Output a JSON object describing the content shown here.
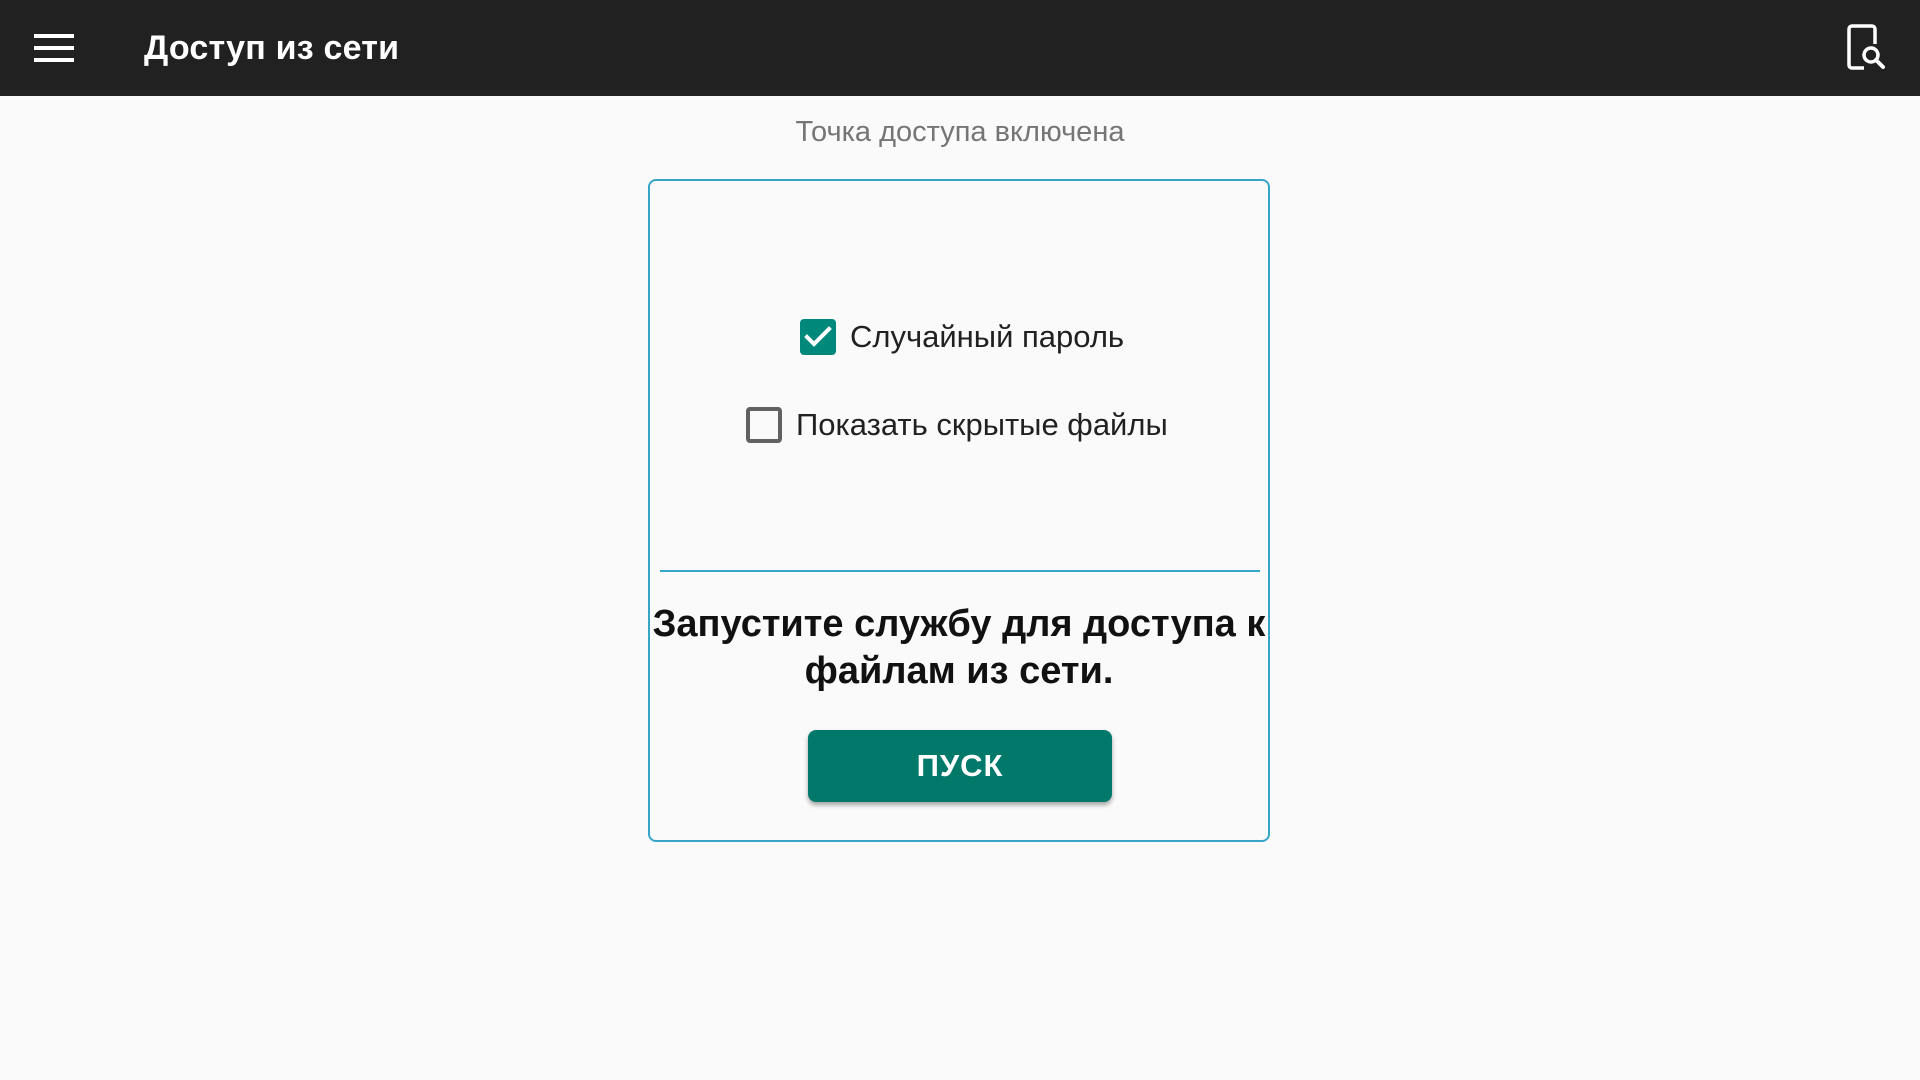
{
  "appbar": {
    "title": "Доступ из сети",
    "menu_icon": "hamburger-menu-icon",
    "search_icon": "device-search-icon",
    "background": "#212121"
  },
  "status": {
    "text": "Точка доступа включена"
  },
  "card": {
    "options": [
      {
        "label": "Случайный пароль",
        "checked": true
      },
      {
        "label": "Показать скрытые файлы",
        "checked": false
      }
    ],
    "message": "Запустите службу для доступа к файлам из сети.",
    "start_button_label": "ПУСК",
    "accent_color": "#00796b",
    "border_color": "#35a6c9"
  }
}
